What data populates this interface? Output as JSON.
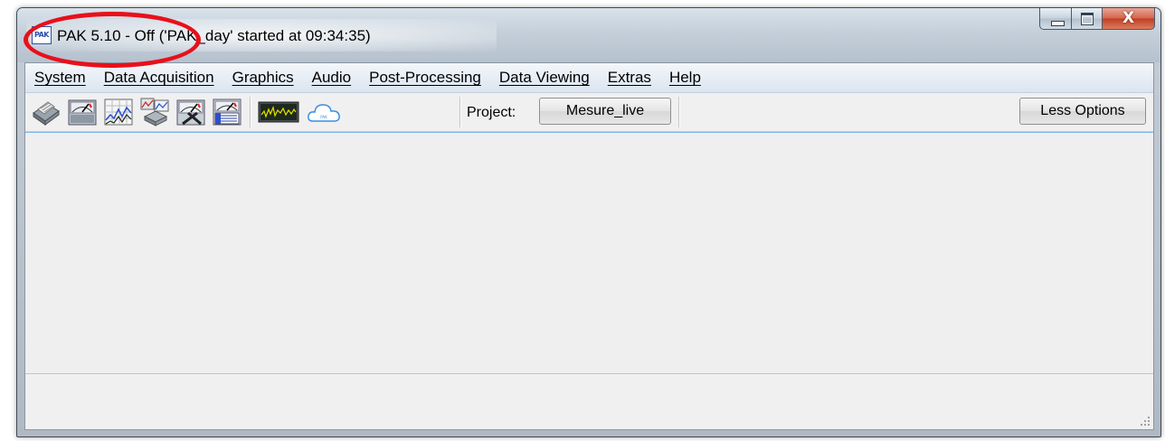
{
  "window": {
    "title": "PAK 5.10 - Off ('PAK_day' started at 09:34:35)",
    "app_icon_text": "PAK",
    "controls": {
      "minimize_icon": "minimize-icon",
      "maximize_icon": "maximize-icon",
      "close_label": "X"
    }
  },
  "menu": {
    "items": [
      {
        "label": "System"
      },
      {
        "label": "Data Acquisition"
      },
      {
        "label": "Graphics"
      },
      {
        "label": "Audio"
      },
      {
        "label": "Post-Processing"
      },
      {
        "label": "Data Viewing"
      },
      {
        "label": "Extras"
      },
      {
        "label": "Help"
      }
    ]
  },
  "toolbar": {
    "icons": [
      "system-hardware-icon",
      "measurement-gauge-icon",
      "graphics-waterfall-icon",
      "post-processing-icon",
      "data-viewing-tools-icon",
      "report-gauge-icon",
      "oscilloscope-live-icon",
      "cloud-icon"
    ],
    "project_label": "Project:",
    "project_value": "Mesure_live",
    "less_options_label": "Less Options"
  },
  "colors": {
    "highlight_ellipse": "#e8101b",
    "menu_bar": "#dbe4ef",
    "close_button": "#c13f22"
  }
}
